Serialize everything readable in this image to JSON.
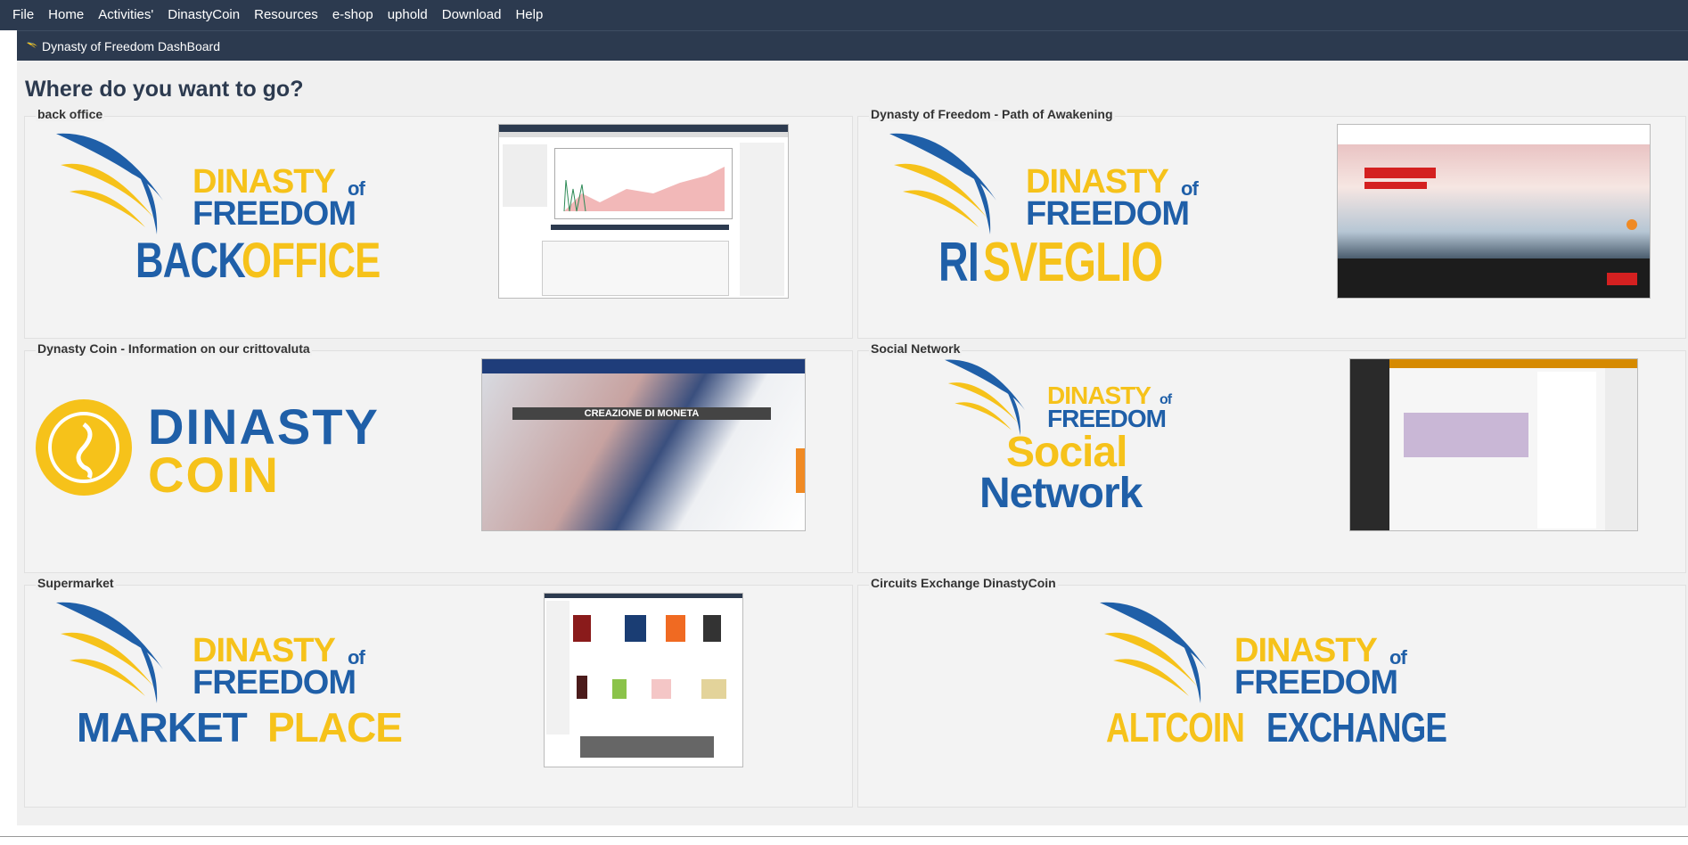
{
  "menu": {
    "items": [
      "File",
      "Home",
      "Activities'",
      "DinastyCoin",
      "Resources",
      "e-shop",
      "uphold",
      "Download",
      "Help"
    ]
  },
  "window": {
    "title": "Dynasty of Freedom DashBoard"
  },
  "main": {
    "heading": "Where do you want to go?",
    "cards": [
      {
        "title": "back office",
        "logo_top": "DINASTY",
        "logo_of": "of",
        "logo_mid": "FREEDOM",
        "logo_a": "BACK",
        "logo_b": "OFFICE"
      },
      {
        "title": "Dynasty of Freedom - Path of Awakening",
        "logo_top": "DINASTY",
        "logo_of": "of",
        "logo_mid": "FREEDOM",
        "logo_a": "RI",
        "logo_b": "SVEGLIO"
      },
      {
        "title": "Dynasty Coin - Information on our crittovaluta",
        "logo_a": "DINASTY",
        "logo_b": "COIN",
        "shot_caption": "CREAZIONE DI MONETA"
      },
      {
        "title": "Social Network",
        "logo_top": "DINASTY",
        "logo_of": "of",
        "logo_mid": "FREEDOM",
        "logo_a": "Social",
        "logo_b": "Network"
      },
      {
        "title": "Supermarket",
        "logo_top": "DINASTY",
        "logo_of": "of",
        "logo_mid": "FREEDOM",
        "logo_a": "MARKET",
        "logo_b": "PLACE"
      },
      {
        "title": "Circuits Exchange DinastyCoin",
        "logo_top": "DINASTY",
        "logo_of": "of",
        "logo_mid": "FREEDOM",
        "logo_a": "ALTCOIN",
        "logo_b": "EXCHANGE"
      }
    ]
  },
  "colors": {
    "navy": "#2c3a4f",
    "brand_blue": "#1f5fa8",
    "brand_yellow": "#f6c21a"
  }
}
